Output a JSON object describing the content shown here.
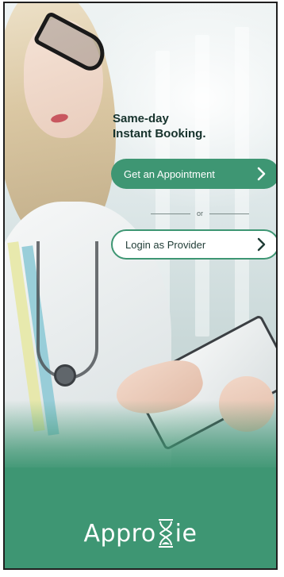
{
  "headline": {
    "line1": "Same-day",
    "line2": "Instant Booking."
  },
  "actions": {
    "primary_label": "Get an Appointment",
    "primary_icon": "chevron-right-icon",
    "divider_text": "or",
    "secondary_label": "Login as Provider",
    "secondary_icon": "chevron-right-icon"
  },
  "brand": {
    "logo_text": "Approxie",
    "logo_prefix": "Appro",
    "logo_suffix": "ie",
    "logo_icon": "hourglass-icon"
  },
  "colors": {
    "brand_green": "#3e9673",
    "headline_text": "#16322c",
    "button_text_light": "#ffffff"
  }
}
